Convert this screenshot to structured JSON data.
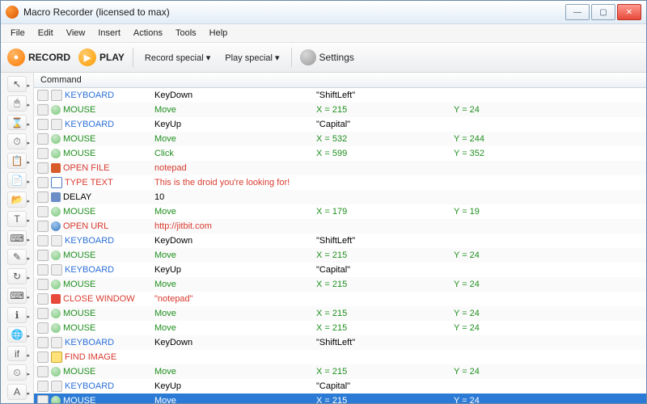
{
  "window": {
    "title": "Macro Recorder (licensed to max)"
  },
  "menu": [
    "File",
    "Edit",
    "View",
    "Insert",
    "Actions",
    "Tools",
    "Help"
  ],
  "toolbar": {
    "record": "RECORD",
    "play": "PLAY",
    "record_special": "Record special",
    "play_special": "Play special",
    "settings": "Settings"
  },
  "sidebar_icons": [
    "cursor-icon",
    "mouse-icon",
    "delay-icon",
    "timer-icon",
    "paste-icon",
    "copy-icon",
    "open-icon",
    "text-icon",
    "keyboard-icon",
    "brush-icon",
    "repeat-icon",
    "type-icon",
    "info-icon",
    "globe-icon",
    "if-icon",
    "wait-icon",
    "font-icon"
  ],
  "column_header": "Command",
  "rows": [
    {
      "icon": "kb",
      "type": "KEYBOARD",
      "cls": "kb",
      "p1": "KeyDown",
      "p2": "\"ShiftLeft\"",
      "p3": ""
    },
    {
      "icon": "ms",
      "type": "MOUSE",
      "cls": "ms",
      "p1": "Move",
      "p2": "X = 215",
      "p3": "Y = 24"
    },
    {
      "icon": "kb",
      "type": "KEYBOARD",
      "cls": "kb",
      "p1": "KeyUp",
      "p2": "\"Capital\"",
      "p3": ""
    },
    {
      "icon": "ms",
      "type": "MOUSE",
      "cls": "ms",
      "p1": "Move",
      "p2": "X = 532",
      "p3": "Y = 244"
    },
    {
      "icon": "ms",
      "type": "MOUSE",
      "cls": "ms",
      "p1": "Click",
      "p2": "X = 599",
      "p3": "Y = 352"
    },
    {
      "icon": "of",
      "type": "OPEN FILE",
      "cls": "sp",
      "p1": "notepad",
      "p2": "",
      "p3": ""
    },
    {
      "icon": "tt",
      "type": "TYPE TEXT",
      "cls": "sp",
      "p1": "This is the droid you're looking for!",
      "p2": "",
      "p3": ""
    },
    {
      "icon": "dl",
      "type": "DELAY",
      "cls": "",
      "p1": "10",
      "p2": "",
      "p3": ""
    },
    {
      "icon": "ms",
      "type": "MOUSE",
      "cls": "ms",
      "p1": "Move",
      "p2": "X = 179",
      "p3": "Y = 19"
    },
    {
      "icon": "url",
      "type": "OPEN URL",
      "cls": "sp",
      "p1": "http://jitbit.com",
      "p2": "",
      "p3": ""
    },
    {
      "icon": "kb",
      "type": "KEYBOARD",
      "cls": "kb",
      "p1": "KeyDown",
      "p2": "\"ShiftLeft\"",
      "p3": ""
    },
    {
      "icon": "ms",
      "type": "MOUSE",
      "cls": "ms",
      "p1": "Move",
      "p2": "X = 215",
      "p3": "Y = 24"
    },
    {
      "icon": "kb",
      "type": "KEYBOARD",
      "cls": "kb",
      "p1": "KeyUp",
      "p2": "\"Capital\"",
      "p3": ""
    },
    {
      "icon": "ms",
      "type": "MOUSE",
      "cls": "ms",
      "p1": "Move",
      "p2": "X = 215",
      "p3": "Y = 24"
    },
    {
      "icon": "cw",
      "type": "CLOSE WINDOW",
      "cls": "sp",
      "p1": "\"notepad\"",
      "p2": "",
      "p3": ""
    },
    {
      "icon": "ms",
      "type": "MOUSE",
      "cls": "ms",
      "p1": "Move",
      "p2": "X = 215",
      "p3": "Y = 24"
    },
    {
      "icon": "ms",
      "type": "MOUSE",
      "cls": "ms",
      "p1": "Move",
      "p2": "X = 215",
      "p3": "Y = 24"
    },
    {
      "icon": "kb",
      "type": "KEYBOARD",
      "cls": "kb",
      "p1": "KeyDown",
      "p2": "\"ShiftLeft\"",
      "p3": ""
    },
    {
      "icon": "fi",
      "type": "FIND IMAGE",
      "cls": "sp",
      "p1": "",
      "p2": "",
      "p3": ""
    },
    {
      "icon": "ms",
      "type": "MOUSE",
      "cls": "ms",
      "p1": "Move",
      "p2": "X = 215",
      "p3": "Y = 24"
    },
    {
      "icon": "kb",
      "type": "KEYBOARD",
      "cls": "kb",
      "p1": "KeyUp",
      "p2": "\"Capital\"",
      "p3": ""
    },
    {
      "icon": "ms",
      "type": "MOUSE",
      "cls": "ms",
      "p1": "Move",
      "p2": "X = 215",
      "p3": "Y = 24",
      "selected": true
    }
  ]
}
